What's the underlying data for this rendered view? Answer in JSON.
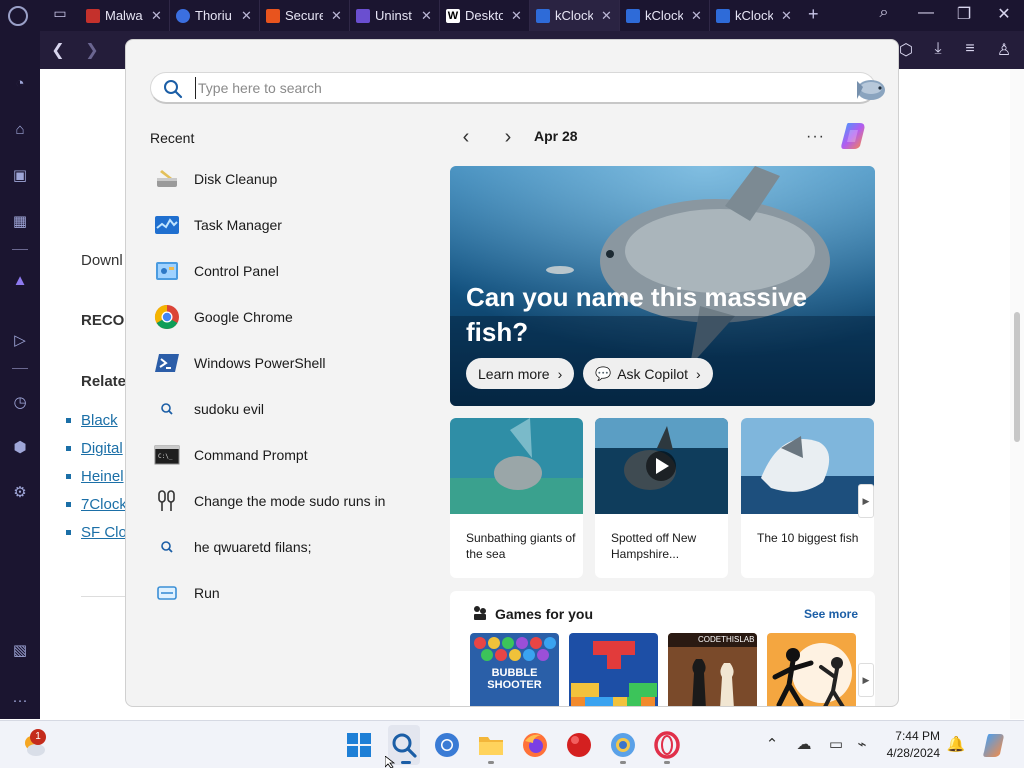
{
  "browser": {
    "tabs": [
      {
        "title": "Malwa",
        "favicon_color": "#c4312c",
        "active": false
      },
      {
        "title": "Thoriu",
        "favicon_color": "#3b6fe0",
        "active": false
      },
      {
        "title": "Secure",
        "favicon_color": "#e8541e",
        "active": false
      },
      {
        "title": "Uninst",
        "favicon_color": "#6a4fd0",
        "active": false
      },
      {
        "title": "Deskto",
        "favicon_color": "#ffffff",
        "active": false
      },
      {
        "title": "kClock",
        "favicon_color": "#2e6bd8",
        "active": true
      },
      {
        "title": "kClock",
        "favicon_color": "#2e6bd8",
        "active": false
      },
      {
        "title": "kClock",
        "favicon_color": "#2e6bd8",
        "active": false
      }
    ],
    "new_tab": "+",
    "sidebar_icons": [
      "speed-dial-icon",
      "extensions-icon",
      "twitch-icon",
      "workspace-icon",
      "aria-icon",
      "player-icon",
      "history-icon",
      "cube-icon",
      "settings-icon",
      "gallery-icon",
      "more-icon"
    ]
  },
  "page": {
    "download_text": "Downl",
    "recommended_text": "RECO",
    "related_text": "Relate",
    "links": [
      "Black",
      "Digital",
      "Heinel",
      "7Clock",
      "SF Clo"
    ]
  },
  "search": {
    "placeholder": "Type here to search",
    "recent_title": "Recent",
    "recent_items": [
      {
        "label": "Disk Cleanup",
        "icon": "disk-cleanup-icon"
      },
      {
        "label": "Task Manager",
        "icon": "task-manager-icon"
      },
      {
        "label": "Control Panel",
        "icon": "control-panel-icon"
      },
      {
        "label": "Google Chrome",
        "icon": "chrome-icon"
      },
      {
        "label": "Windows PowerShell",
        "icon": "powershell-icon"
      },
      {
        "label": "sudoku evil",
        "icon": "search-icon"
      },
      {
        "label": "Command Prompt",
        "icon": "command-prompt-icon"
      },
      {
        "label": "Change the mode sudo runs in",
        "icon": "sudo-settings-icon"
      },
      {
        "label": "he qwuaretd filans;",
        "icon": "search-icon"
      },
      {
        "label": "Run",
        "icon": "run-icon"
      }
    ],
    "date_label": "Apr 28",
    "more_label": "···",
    "hero": {
      "title": "Can you name this massive fish?",
      "learn_more": "Learn more",
      "ask_copilot": "Ask Copilot"
    },
    "cards": [
      {
        "caption": "Sunbathing giants of the sea",
        "has_video": false
      },
      {
        "caption": "Spotted off New Hampshire...",
        "has_video": true
      },
      {
        "caption": "The 10 biggest fish",
        "has_video": false
      }
    ],
    "games": {
      "title": "Games for you",
      "see_more": "See more",
      "tiles": [
        {
          "name": "bubble-shooter",
          "label": "BUBBLE SHOOTER"
        },
        {
          "name": "block-puzzle",
          "label": ""
        },
        {
          "name": "chess",
          "label": "CODETHISLAB"
        },
        {
          "name": "stickman-fight",
          "label": ""
        }
      ]
    }
  },
  "taskbar": {
    "widget_badge": "1",
    "time": "7:44 PM",
    "date": "4/28/2024",
    "apps": [
      "start-icon",
      "search-icon",
      "chrome-icon",
      "file-explorer-icon",
      "firefox-icon",
      "red-ball-icon",
      "thorium-icon",
      "opera-icon"
    ]
  },
  "colors": {
    "accent": "#1b5ea6",
    "browser_bg": "#1b1530",
    "flyout_bg": "#f3f3f3",
    "taskbar_bg": "#f1f3f9"
  }
}
